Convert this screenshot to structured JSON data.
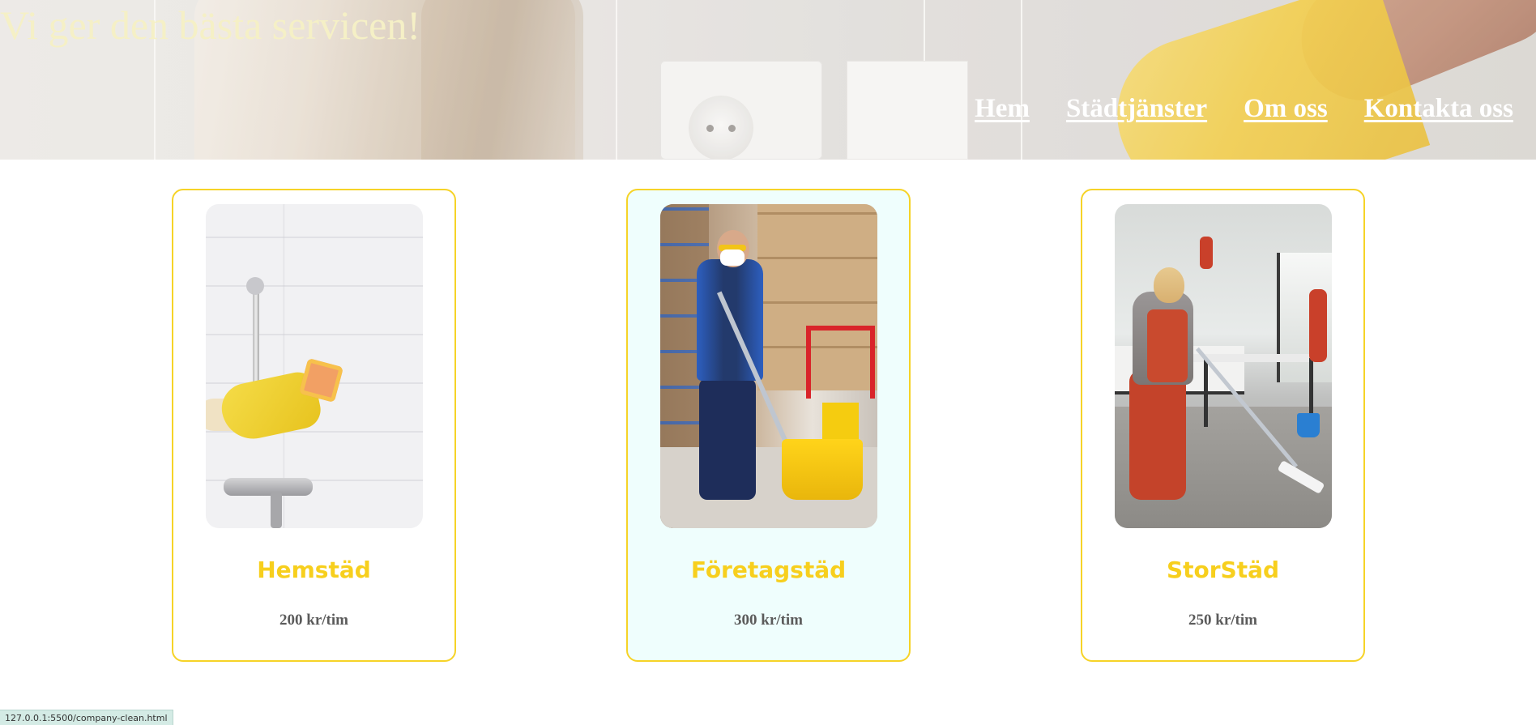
{
  "header": {
    "title": "Vi ger den bästa servicen!",
    "nav": [
      {
        "label": "Hem"
      },
      {
        "label": "Städtjänster"
      },
      {
        "label": "Om oss"
      },
      {
        "label": "Kontakta oss"
      }
    ]
  },
  "services": [
    {
      "title": "Hemstäd",
      "price": "200 kr/tim",
      "image": "bathroom-cleaning-photo"
    },
    {
      "title": "Företagstäd",
      "price": "300 kr/tim",
      "image": "warehouse-cleaning-photo"
    },
    {
      "title": "StorStäd",
      "price": "250 kr/tim",
      "image": "kitchen-cleaning-photo"
    }
  ],
  "status_bar": {
    "url": "127.0.0.1:5500/company-clean.html"
  },
  "colors": {
    "title_text": "#f5f0c6",
    "card_border": "#f6d327",
    "card_title": "#f7cf1d",
    "price_text": "#5b5b5b",
    "highlight_bg": "#effefd"
  }
}
